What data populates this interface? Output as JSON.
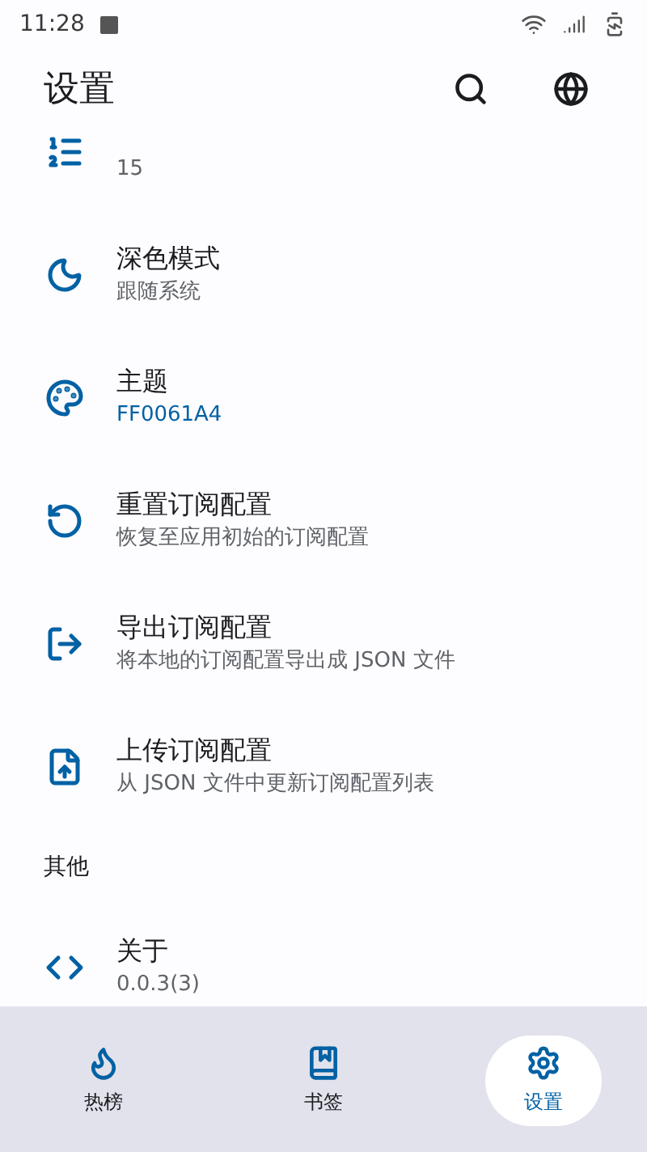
{
  "status_bar": {
    "time": "11:28"
  },
  "app_bar": {
    "title": "设置"
  },
  "sections": [
    {
      "items": [
        {
          "subtitle": "15",
          "accent": false
        },
        {
          "title": "深色模式",
          "subtitle": "跟随系统",
          "accent": false
        },
        {
          "title": "主题",
          "subtitle": "FF0061A4",
          "accent": true
        },
        {
          "title": "重置订阅配置",
          "subtitle": "恢复至应用初始的订阅配置",
          "accent": false
        },
        {
          "title": "导出订阅配置",
          "subtitle": "将本地的订阅配置导出成 JSON 文件",
          "accent": false
        },
        {
          "title": "上传订阅配置",
          "subtitle": "从 JSON 文件中更新订阅配置列表",
          "accent": false
        }
      ]
    },
    {
      "header": "其他",
      "items": [
        {
          "title": "关于",
          "subtitle": "0.0.3(3)",
          "accent": false
        }
      ]
    }
  ],
  "nav": [
    {
      "label": "热榜",
      "selected": false
    },
    {
      "label": "书签",
      "selected": false
    },
    {
      "label": "设置",
      "selected": true
    }
  ]
}
